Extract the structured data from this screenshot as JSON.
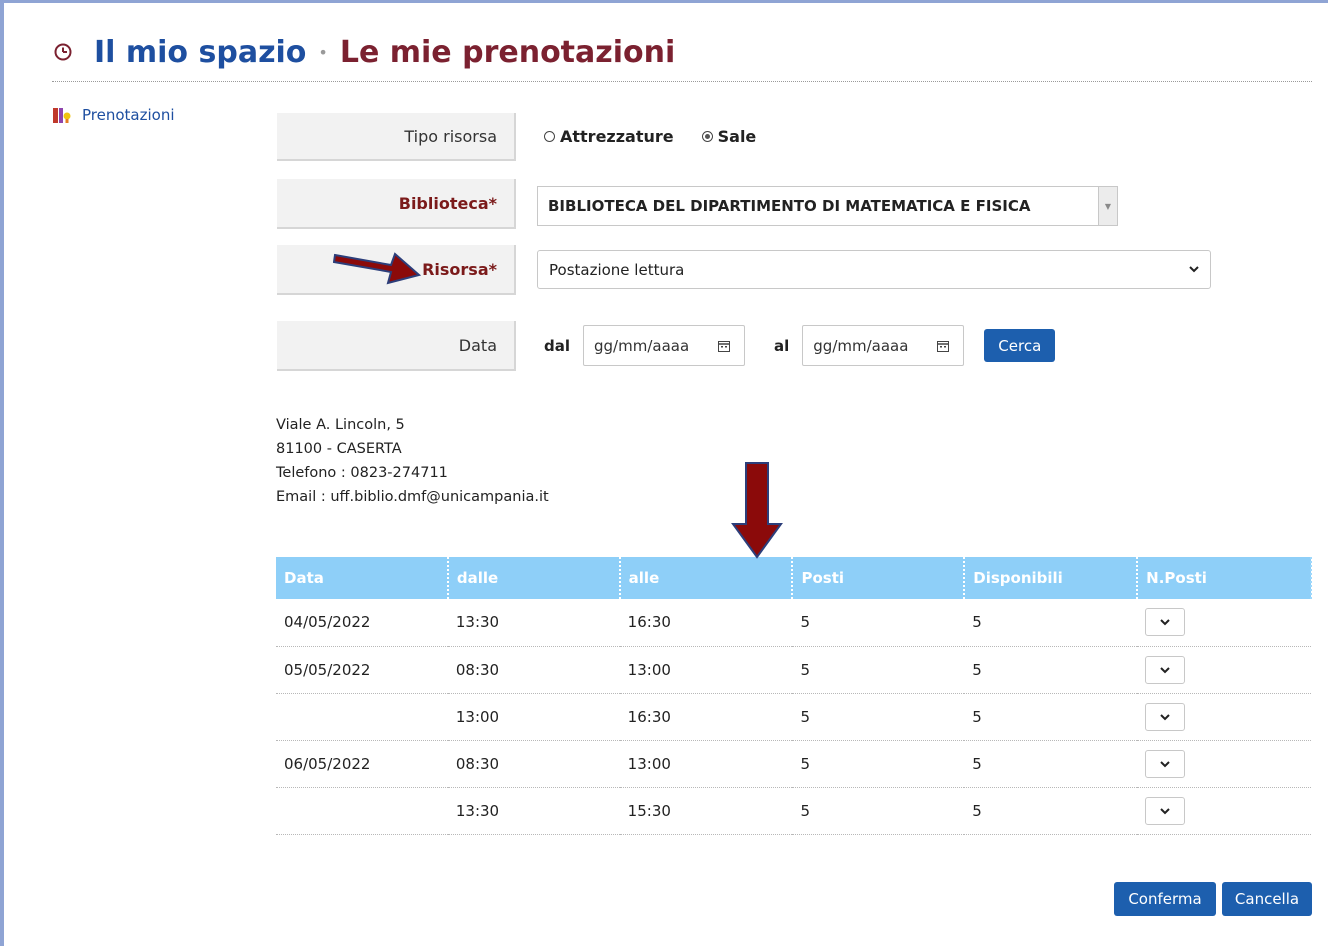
{
  "header": {
    "title": "Il mio spazio",
    "separator": "•",
    "subtitle": "Le mie prenotazioni"
  },
  "sidebar": {
    "items": [
      {
        "label": "Prenotazioni",
        "icon": "books-icon"
      }
    ]
  },
  "form": {
    "tipo_label": "Tipo risorsa",
    "tipo_options": [
      {
        "label": "Attrezzature",
        "checked": false
      },
      {
        "label": "Sale",
        "checked": true
      }
    ],
    "biblioteca_label": "Biblioteca*",
    "biblioteca_value": "BIBLIOTECA DEL DIPARTIMENTO DI MATEMATICA E FISICA",
    "risorsa_label": "Risorsa*",
    "risorsa_value": "Postazione lettura",
    "data_label": "Data",
    "dal_label": "dal",
    "dal_placeholder": "gg/mm/aaaa",
    "al_label": "al",
    "al_placeholder": "gg/mm/aaaa",
    "cerca_label": "Cerca"
  },
  "address": {
    "line1": "Viale A. Lincoln, 5",
    "line2": "81100 - CASERTA",
    "phone": "Telefono : 0823-274711",
    "email": "Email : uff.biblio.dmf@unicampania.it"
  },
  "table": {
    "headers": [
      "Data",
      "dalle",
      "alle",
      "Posti",
      "Disponibili",
      "N.Posti"
    ],
    "rows": [
      {
        "data": "04/05/2022",
        "dalle": "13:30",
        "alle": "16:30",
        "posti": "5",
        "disponibili": "5"
      },
      {
        "data": "05/05/2022",
        "dalle": "08:30",
        "alle": "13:00",
        "posti": "5",
        "disponibili": "5"
      },
      {
        "data": "",
        "dalle": "13:00",
        "alle": "16:30",
        "posti": "5",
        "disponibili": "5"
      },
      {
        "data": "06/05/2022",
        "dalle": "08:30",
        "alle": "13:00",
        "posti": "5",
        "disponibili": "5"
      },
      {
        "data": "",
        "dalle": "13:30",
        "alle": "15:30",
        "posti": "5",
        "disponibili": "5"
      }
    ]
  },
  "actions": {
    "conferma": "Conferma",
    "cancella": "Cancella"
  },
  "colors": {
    "title_blue": "#1e4fa0",
    "subtitle_maroon": "#7b2130",
    "table_header": "#8ecff8",
    "button_blue": "#1d5fae",
    "annotation_arrow": "#8b0a0a"
  }
}
